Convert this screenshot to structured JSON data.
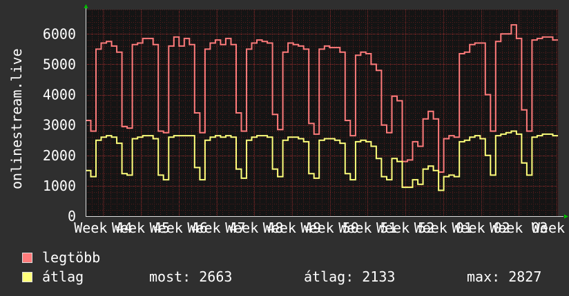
{
  "chart_data": {
    "type": "line",
    "ylabel": "onlinestream.live",
    "ylim": [
      0,
      6800
    ],
    "yticks": [
      0,
      1000,
      2000,
      3000,
      4000,
      5000,
      6000
    ],
    "xticks": [
      "Week 44",
      "Week 45",
      "Week 46",
      "Week 47",
      "Week 48",
      "Week 49",
      "Week 50",
      "Week 51",
      "Week 52",
      "Week 01",
      "Week 02",
      "Week 03",
      "Week 0"
    ],
    "grid": true,
    "series": [
      {
        "name": "legtöbb",
        "color": "#ff7b7b",
        "values": [
          3150,
          2800,
          5500,
          5700,
          5750,
          5600,
          5400,
          2950,
          2900,
          5650,
          5700,
          5850,
          5850,
          5650,
          2800,
          2750,
          5600,
          5900,
          5600,
          5850,
          5650,
          3400,
          2750,
          5500,
          5700,
          5800,
          5650,
          5850,
          5650,
          3400,
          2800,
          5500,
          5700,
          5800,
          5750,
          5700,
          3350,
          2850,
          5400,
          5700,
          5650,
          5600,
          5500,
          3050,
          2700,
          5500,
          5600,
          5550,
          5550,
          5400,
          3150,
          2650,
          5300,
          5400,
          5350,
          5000,
          4800,
          3000,
          2750,
          3950,
          3800,
          1800,
          1850,
          2450,
          2300,
          3200,
          3450,
          3200,
          1450,
          2550,
          2650,
          2600,
          5350,
          5400,
          5650,
          5700,
          5700,
          4000,
          2800,
          5750,
          6000,
          6000,
          6300,
          5850,
          3500,
          2800,
          5800,
          5850,
          5900,
          5900,
          5800
        ]
      },
      {
        "name": "átlag",
        "color": "#ffff7b",
        "values": [
          1500,
          1300,
          2500,
          2600,
          2650,
          2600,
          2400,
          1400,
          1350,
          2550,
          2600,
          2650,
          2650,
          2550,
          1350,
          1200,
          2600,
          2650,
          2650,
          2650,
          2650,
          1600,
          1200,
          2500,
          2600,
          2650,
          2600,
          2650,
          2600,
          1550,
          1250,
          2500,
          2600,
          2650,
          2650,
          2600,
          1550,
          1300,
          2500,
          2600,
          2600,
          2550,
          2450,
          1400,
          1250,
          2500,
          2550,
          2550,
          2500,
          2400,
          1400,
          1200,
          2450,
          2500,
          2450,
          2300,
          1900,
          1300,
          1200,
          1900,
          1800,
          950,
          950,
          1200,
          1050,
          1550,
          1650,
          1500,
          850,
          1300,
          1350,
          1300,
          2450,
          2500,
          2600,
          2650,
          2550,
          2000,
          1350,
          2650,
          2700,
          2750,
          2800,
          2700,
          1750,
          1350,
          2600,
          2650,
          2700,
          2700,
          2650
        ]
      }
    ]
  },
  "legend": [
    {
      "label": "legtöbb",
      "color": "#ff7b7b"
    },
    {
      "label": "átlag",
      "color": "#ffff7b"
    }
  ],
  "stats": {
    "now": "most: 2663",
    "avg": "átlag: 2133",
    "max": "max: 2827"
  }
}
